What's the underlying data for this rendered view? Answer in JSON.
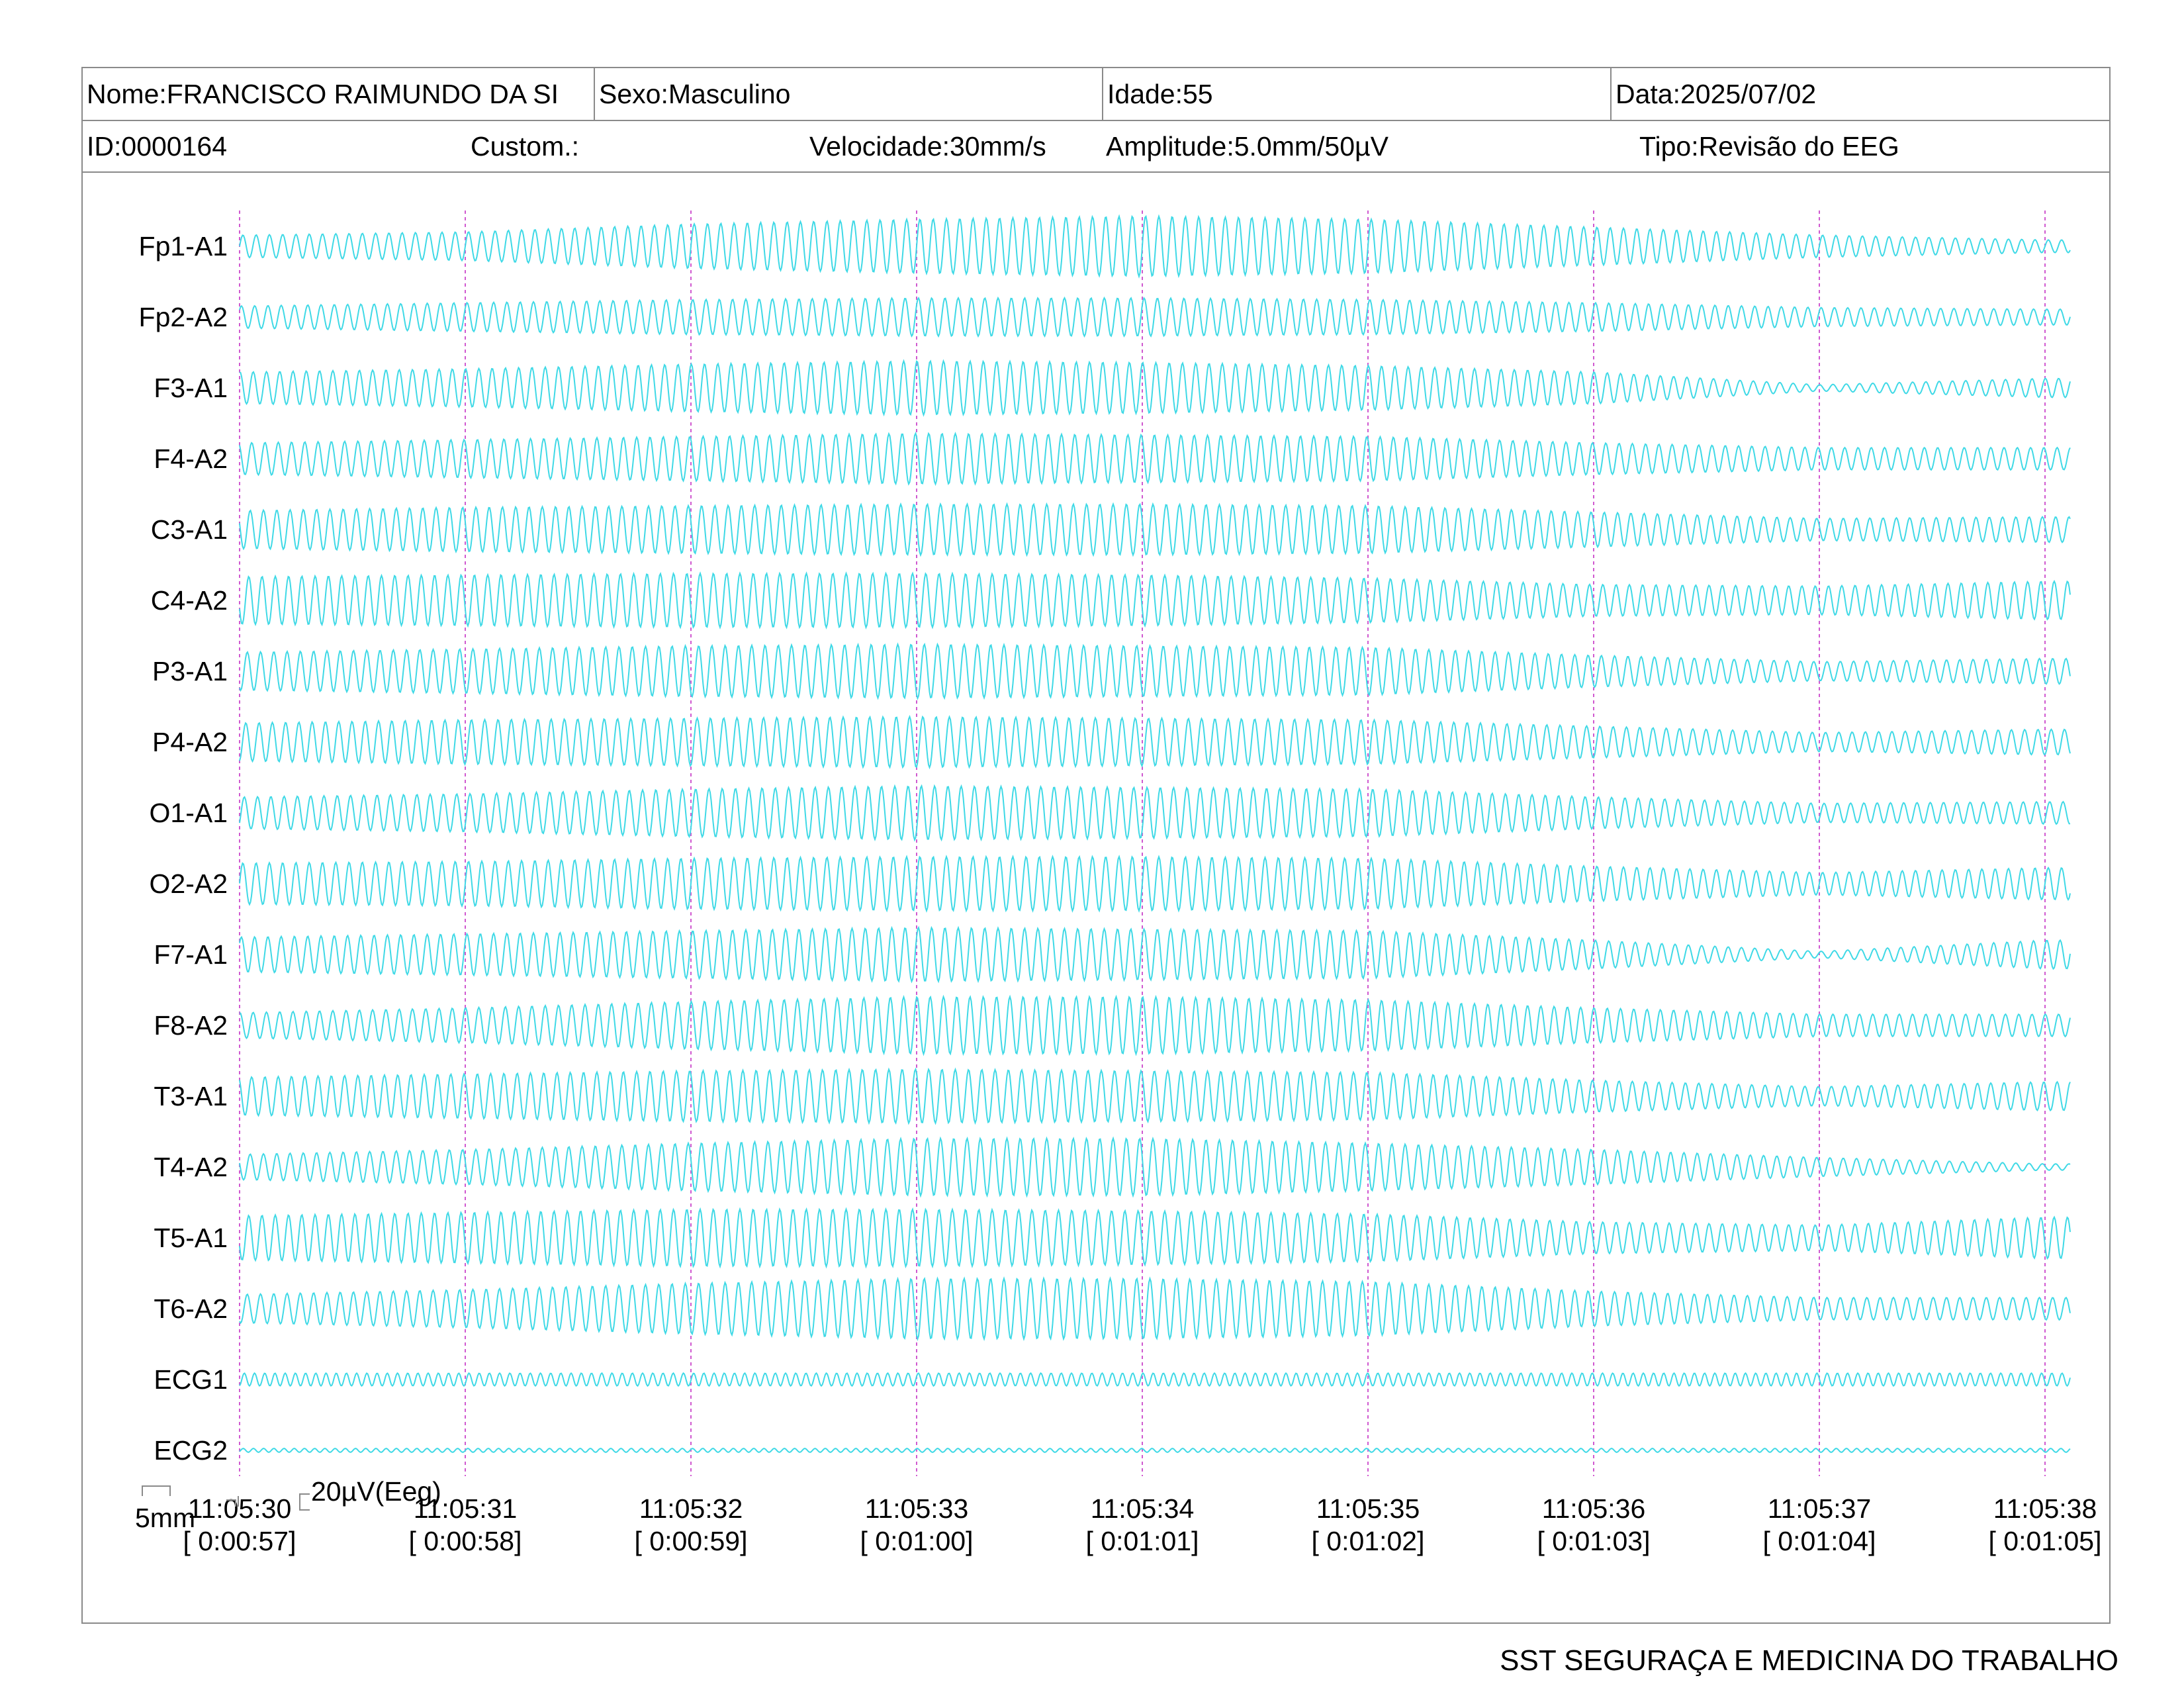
{
  "header": {
    "name": "Nome:FRANCISCO RAIMUNDO DA SI",
    "sex": "Sexo:Masculino",
    "age": "Idade:55",
    "date": "Data:2025/07/02",
    "id": "ID:0000164",
    "custom": "Custom.:",
    "speed": "Velocidade:30mm/s",
    "amplitude": "Amplitude:5.0mm/50µV",
    "type": "Tipo:Revisão do EEG"
  },
  "colors": {
    "trace": "#3fd9e6",
    "marker": "#d05ad0",
    "border": "#8a8a8a"
  },
  "chart_data": {
    "type": "line",
    "title": "",
    "xlabel": "",
    "ylabel": "",
    "grid": false,
    "x_ticks": [
      {
        "clock": "11:05:30",
        "elapsed": "[ 0:00:57]"
      },
      {
        "clock": "11:05:31",
        "elapsed": "[ 0:00:58]"
      },
      {
        "clock": "11:05:32",
        "elapsed": "[ 0:00:59]"
      },
      {
        "clock": "11:05:33",
        "elapsed": "[ 0:01:00]"
      },
      {
        "clock": "11:05:34",
        "elapsed": "[ 0:01:01]"
      },
      {
        "clock": "11:05:35",
        "elapsed": "[ 0:01:02]"
      },
      {
        "clock": "11:05:36",
        "elapsed": "[ 0:01:03]"
      },
      {
        "clock": "11:05:37",
        "elapsed": "[ 0:01:04]"
      },
      {
        "clock": "11:05:38",
        "elapsed": "[ 0:01:05]"
      }
    ],
    "channels": [
      {
        "name": "Fp1-A1",
        "amplitude_envelope": [
          0.35,
          0.45,
          0.7,
          0.85,
          0.95,
          0.85,
          0.6,
          0.35,
          0.2
        ]
      },
      {
        "name": "Fp2-A2",
        "amplitude_envelope": [
          0.35,
          0.45,
          0.55,
          0.6,
          0.6,
          0.55,
          0.45,
          0.3,
          0.25
        ]
      },
      {
        "name": "F3-A1",
        "amplitude_envelope": [
          0.5,
          0.6,
          0.75,
          0.85,
          0.8,
          0.7,
          0.5,
          0.1,
          0.3
        ]
      },
      {
        "name": "F4-A2",
        "amplitude_envelope": [
          0.5,
          0.6,
          0.7,
          0.8,
          0.75,
          0.7,
          0.5,
          0.35,
          0.35
        ]
      },
      {
        "name": "C3-A1",
        "amplitude_envelope": [
          0.6,
          0.7,
          0.75,
          0.8,
          0.8,
          0.75,
          0.55,
          0.35,
          0.4
        ]
      },
      {
        "name": "C4-A2",
        "amplitude_envelope": [
          0.75,
          0.8,
          0.85,
          0.85,
          0.8,
          0.7,
          0.5,
          0.45,
          0.6
        ]
      },
      {
        "name": "P3-A1",
        "amplitude_envelope": [
          0.6,
          0.7,
          0.8,
          0.85,
          0.8,
          0.75,
          0.5,
          0.3,
          0.4
        ]
      },
      {
        "name": "P4-A2",
        "amplitude_envelope": [
          0.6,
          0.7,
          0.75,
          0.8,
          0.75,
          0.7,
          0.5,
          0.3,
          0.4
        ]
      },
      {
        "name": "O1-A1",
        "amplitude_envelope": [
          0.5,
          0.6,
          0.75,
          0.85,
          0.8,
          0.75,
          0.5,
          0.3,
          0.35
        ]
      },
      {
        "name": "O2-A2",
        "amplitude_envelope": [
          0.65,
          0.7,
          0.8,
          0.85,
          0.85,
          0.8,
          0.55,
          0.35,
          0.5
        ]
      },
      {
        "name": "F7-A1",
        "amplitude_envelope": [
          0.55,
          0.65,
          0.75,
          0.85,
          0.8,
          0.75,
          0.45,
          0.1,
          0.45
        ]
      },
      {
        "name": "F8-A2",
        "amplitude_envelope": [
          0.4,
          0.55,
          0.75,
          0.9,
          0.9,
          0.8,
          0.55,
          0.35,
          0.35
        ]
      },
      {
        "name": "T3-A1",
        "amplitude_envelope": [
          0.6,
          0.7,
          0.8,
          0.85,
          0.8,
          0.75,
          0.5,
          0.3,
          0.45
        ]
      },
      {
        "name": "T4-A2",
        "amplitude_envelope": [
          0.4,
          0.55,
          0.75,
          0.9,
          0.9,
          0.75,
          0.55,
          0.3,
          0.1
        ]
      },
      {
        "name": "T5-A1",
        "amplitude_envelope": [
          0.7,
          0.8,
          0.9,
          0.9,
          0.85,
          0.75,
          0.5,
          0.4,
          0.65
        ]
      },
      {
        "name": "T6-A2",
        "amplitude_envelope": [
          0.45,
          0.6,
          0.8,
          0.95,
          0.95,
          0.85,
          0.55,
          0.35,
          0.35
        ]
      },
      {
        "name": "ECG1",
        "amplitude_envelope": [
          0.2,
          0.2,
          0.2,
          0.2,
          0.2,
          0.2,
          0.2,
          0.2,
          0.2
        ]
      },
      {
        "name": "ECG2",
        "amplitude_envelope": [
          0.06,
          0.06,
          0.06,
          0.06,
          0.06,
          0.06,
          0.06,
          0.06,
          0.06
        ]
      }
    ],
    "cycles_per_second": 17
  },
  "scale_bar": {
    "time_label": "5mm",
    "amp_label": "20µV(Eeg)"
  },
  "footer": {
    "organization": "SST SEGURAÇA E MEDICINA DO TRABALHO"
  }
}
